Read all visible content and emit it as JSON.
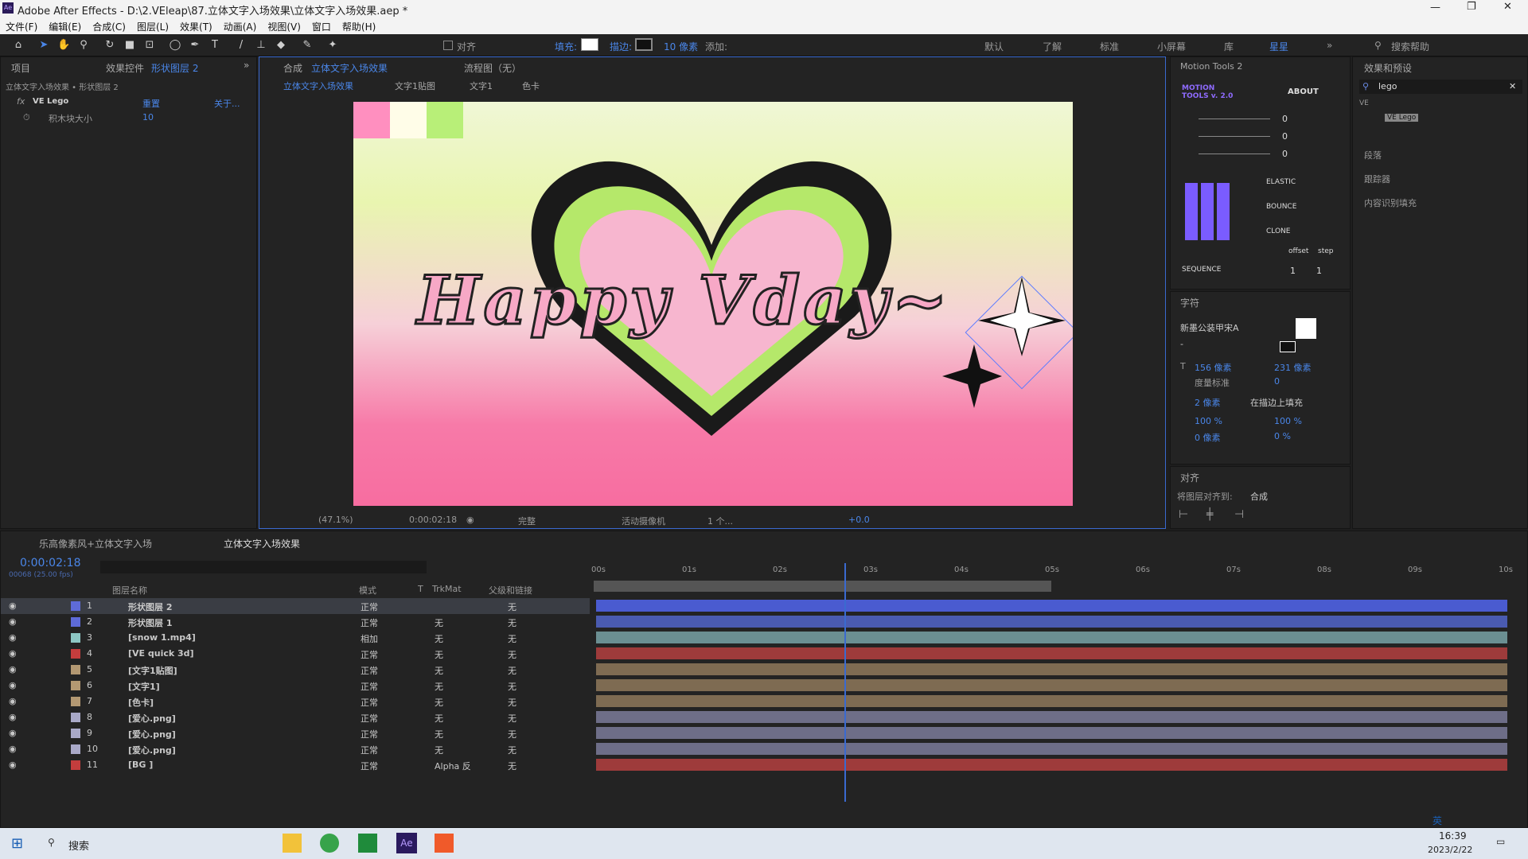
{
  "window": {
    "title": "Adobe After Effects - D:\\2.VEleap\\87.立体文字入场效果\\立体文字入场效果.aep *",
    "app_icon": "Ae"
  },
  "menu": [
    "文件(F)",
    "编辑(E)",
    "合成(C)",
    "图层(L)",
    "效果(T)",
    "动画(A)",
    "视图(V)",
    "窗口",
    "帮助(H)"
  ],
  "toolbar": {
    "align": "对齐",
    "fill": "填充:",
    "stroke": "描边:",
    "stroke_size": "10 像素",
    "add": "添加:",
    "workspaces": [
      "默认",
      "了解",
      "标准",
      "小屏幕",
      "库",
      "星星"
    ],
    "search_help": "搜索帮助"
  },
  "left_panel": {
    "tab_project": "项目",
    "tab_effects": "效果控件",
    "tab_effects_layer": "形状图层 2",
    "breadcrumb": "立体文字入场效果 • 形状图层 2",
    "fx_name": "VE Lego",
    "reset": "重置",
    "about": "关于...",
    "param_label": "积木块大小",
    "param_value": "10"
  },
  "comp_panel": {
    "tab_label": "合成",
    "tab_name": "立体文字入场效果",
    "flow": "流程图（无）",
    "crumbs": [
      "立体文字入场效果",
      "文字1贴图",
      "文字1",
      "色卡"
    ],
    "zoom": "(47.1%)",
    "time": "0:00:02:18",
    "quality": "完整",
    "camera": "活动摄像机",
    "views": "1 个...",
    "exposure": "+0.0",
    "canvas_text": "Happy Vday~"
  },
  "motion_tools": {
    "title": "Motion Tools 2",
    "logo": "MOTION TOOLS v. 2.0",
    "about": "ABOUT",
    "sliders": [
      "0",
      "0",
      "0"
    ],
    "elastic": "ELASTIC",
    "bounce": "BOUNCE",
    "clone": "CLONE",
    "offset": "offset",
    "step": "step",
    "sequence": "SEQUENCE",
    "seq_vals": [
      "1",
      "1"
    ]
  },
  "character": {
    "title": "字符",
    "font": "新墨公装甲宋A",
    "style": "-",
    "size": "156 像素",
    "leading": "231 像素",
    "kerning": "度量标准",
    "tracking": "0",
    "stroke": "2 像素",
    "stroke_mode": "在描边上填充",
    "vscale": "100 %",
    "hscale": "100 %",
    "baseline": "0 像素",
    "tsume": "0 %"
  },
  "align": {
    "title": "对齐",
    "align_to_label": "将图层对齐到:",
    "align_to": "合成"
  },
  "effects_presets": {
    "title": "效果和预设",
    "search": "lego",
    "group": "VE",
    "item": "VE Lego",
    "sections": [
      "段落",
      "跟踪器",
      "内容识别填充"
    ]
  },
  "timeline": {
    "tabs": [
      "乐高像素风+立体文字入场",
      "立体文字入场效果"
    ],
    "timecode": "0:00:02:18",
    "fps": "00068 (25.00 fps)",
    "col_name": "图层名称",
    "col_mode": "模式",
    "col_t": "T",
    "col_trk": "TrkMat",
    "col_parent": "父级和链接",
    "ruler": [
      "00s",
      "01s",
      "02s",
      "03s",
      "04s",
      "05s",
      "06s",
      "07s",
      "08s",
      "09s",
      "10s"
    ],
    "layers": [
      {
        "num": "1",
        "name": "形状图层 2",
        "mode": "正常",
        "trk": "",
        "parent": "无",
        "color": "#5e6bd8",
        "bar": "#4a5bd0",
        "sel": true
      },
      {
        "num": "2",
        "name": "形状图层 1",
        "mode": "正常",
        "trk": "无",
        "parent": "无",
        "color": "#5e6bd8",
        "bar": "#4a5bb0",
        "sel": false
      },
      {
        "num": "3",
        "name": "[snow 1.mp4]",
        "mode": "相加",
        "trk": "无",
        "parent": "无",
        "color": "#8dc7c4",
        "bar": "#6b8f92",
        "sel": false
      },
      {
        "num": "4",
        "name": "[VE quick 3d]",
        "mode": "正常",
        "trk": "无",
        "parent": "无",
        "color": "#c43d3d",
        "bar": "#9e3b3b",
        "sel": false
      },
      {
        "num": "5",
        "name": "[文字1贴图]",
        "mode": "正常",
        "trk": "无",
        "parent": "无",
        "color": "#b39872",
        "bar": "#7e6b52",
        "sel": false
      },
      {
        "num": "6",
        "name": "[文字1]",
        "mode": "正常",
        "trk": "无",
        "parent": "无",
        "color": "#b39872",
        "bar": "#7e6b52",
        "sel": false
      },
      {
        "num": "7",
        "name": "[色卡]",
        "mode": "正常",
        "trk": "无",
        "parent": "无",
        "color": "#b39872",
        "bar": "#7e6b52",
        "sel": false
      },
      {
        "num": "8",
        "name": "[爱心.png]",
        "mode": "正常",
        "trk": "无",
        "parent": "无",
        "color": "#a9a9c8",
        "bar": "#6e6e88",
        "sel": false
      },
      {
        "num": "9",
        "name": "[爱心.png]",
        "mode": "正常",
        "trk": "无",
        "parent": "无",
        "color": "#a9a9c8",
        "bar": "#6e6e88",
        "sel": false
      },
      {
        "num": "10",
        "name": "[爱心.png]",
        "mode": "正常",
        "trk": "无",
        "parent": "无",
        "color": "#a9a9c8",
        "bar": "#6e6e88",
        "sel": false
      },
      {
        "num": "11",
        "name": "[BG ]",
        "mode": "正常",
        "trk": "Alpha 反",
        "parent": "无",
        "color": "#c43d3d",
        "bar": "#9e3b3b",
        "sel": false
      }
    ]
  },
  "taskbar": {
    "search": "搜索",
    "time": "16:39",
    "date": "2023/2/22",
    "ime": "英"
  }
}
